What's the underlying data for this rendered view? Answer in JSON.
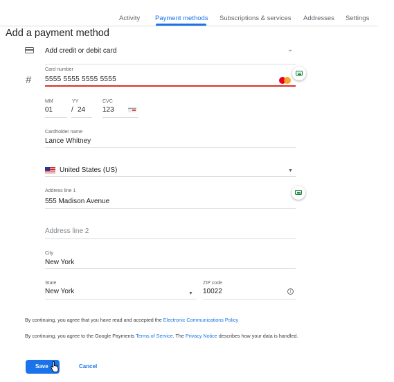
{
  "nav": {
    "tabs": [
      {
        "label": "Activity"
      },
      {
        "label": "Payment methods",
        "active": true
      },
      {
        "label": "Subscriptions & services"
      },
      {
        "label": "Addresses"
      },
      {
        "label": "Settings"
      }
    ]
  },
  "page": {
    "title": "Add a payment method"
  },
  "method_selector": {
    "label": "Add credit or debit card",
    "icon": "credit-card-icon"
  },
  "card_number": {
    "label": "Card number",
    "value": "5555  5555  5555  5555",
    "brand_icon": "mastercard-icon",
    "autofill_icon": "autofill-card-icon"
  },
  "expiry": {
    "month_label": "MM",
    "month_value": "01",
    "year_label": "YY",
    "year_value": "24",
    "separator": "/"
  },
  "cvc": {
    "label": "CVC",
    "value": "123",
    "icon": "cvc-card-icon"
  },
  "cardholder": {
    "label": "Cardholder name",
    "value": "Lance Whitney"
  },
  "country": {
    "value": "United States (US)",
    "flag_icon": "us-flag-icon"
  },
  "address1": {
    "label": "Address line 1",
    "value": "555 Madison Avenue",
    "autofill_icon": "autofill-address-icon"
  },
  "address2": {
    "placeholder": "Address line 2"
  },
  "city": {
    "label": "City",
    "value": "New York"
  },
  "state": {
    "label": "State",
    "value": "New York"
  },
  "zip": {
    "label": "ZIP code",
    "value": "10022",
    "info_icon": "info-icon"
  },
  "legal": {
    "line1_prefix": "By continuing, you agree that you have read and accepted the ",
    "line1_link": "Electronic Communications Policy",
    "line2_prefix": "By continuing, you agree to the Google Payments ",
    "line2_link1": "Terms of Service",
    "line2_mid": ". The ",
    "line2_link2": "Privacy Notice",
    "line2_suffix": " describes how your data is handled."
  },
  "actions": {
    "save_label": "Save",
    "cancel_label": "Cancel"
  },
  "colors": {
    "accent": "#1a73e8",
    "error_underline": "#d93025",
    "autofill_green": "#188038"
  }
}
